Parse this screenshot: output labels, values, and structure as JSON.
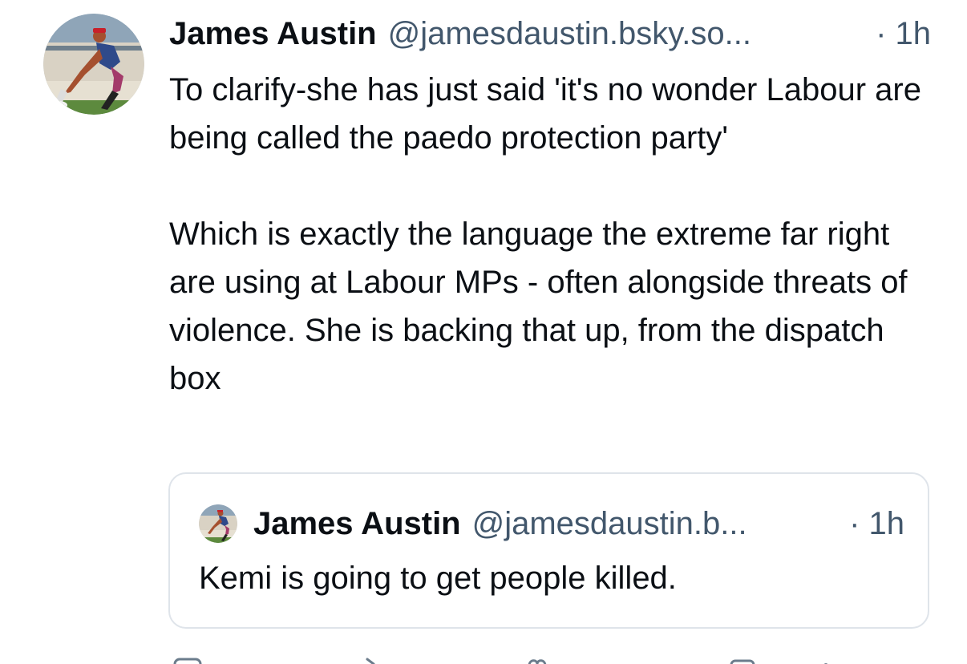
{
  "post": {
    "author": {
      "display_name": "James Austin",
      "handle": "@jamesdaustin.bsky.so...",
      "avatar_icon": "avatar-photo-icon"
    },
    "time": "· 1h",
    "paragraphs": [
      "To clarify-she has just said 'it's no wonder Labour are being called the paedo protection party'",
      "Which is exactly the language the extreme far right are using at Labour MPs - often alongside threats of violence. She is backing that up, from the dispatch box"
    ]
  },
  "quote": {
    "author": {
      "display_name": "James Austin",
      "handle": "@jamesdaustin.b...",
      "avatar_icon": "avatar-photo-icon"
    },
    "time": "· 1h",
    "text": "Kemi is going to get people killed."
  },
  "actions": [
    {
      "icon": "reply-icon"
    },
    {
      "icon": "repost-icon"
    },
    {
      "icon": "like-icon"
    },
    {
      "icon": "share-icon"
    },
    {
      "icon": "more-icon"
    }
  ],
  "colors": {
    "text": "#0b0f14",
    "muted": "#42576c",
    "border": "#dfe4ea"
  }
}
